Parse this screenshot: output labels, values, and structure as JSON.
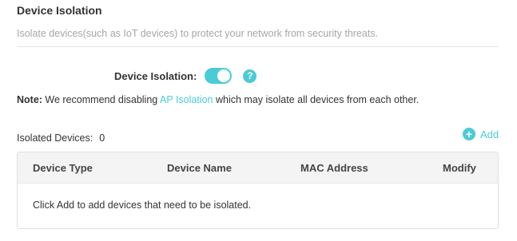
{
  "section": {
    "title": "Device Isolation",
    "description": "Isolate devices(such as IoT devices) to protect your network from security threats."
  },
  "isolation": {
    "label": "Device Isolation:",
    "enabled": true,
    "help_symbol": "?"
  },
  "note": {
    "prefix": "Note:",
    "text_before": " We recommend disabling ",
    "link": "AP Isolation",
    "text_after": " which may isolate all devices from each other."
  },
  "devices": {
    "label": "Isolated Devices:",
    "count": "0",
    "add_symbol": "+",
    "add_label": "Add"
  },
  "table": {
    "columns": [
      "Device Type",
      "Device Name",
      "MAC Address",
      "Modify"
    ],
    "empty_message": "Click Add to add devices that need to be isolated."
  },
  "colors": {
    "accent": "#4acbd6",
    "muted_text": "#a6a6a6",
    "text": "#333333"
  },
  "icons": {
    "toggle": "toggle-switch-on",
    "help": "question-circle-icon",
    "add": "plus-circle-icon"
  }
}
